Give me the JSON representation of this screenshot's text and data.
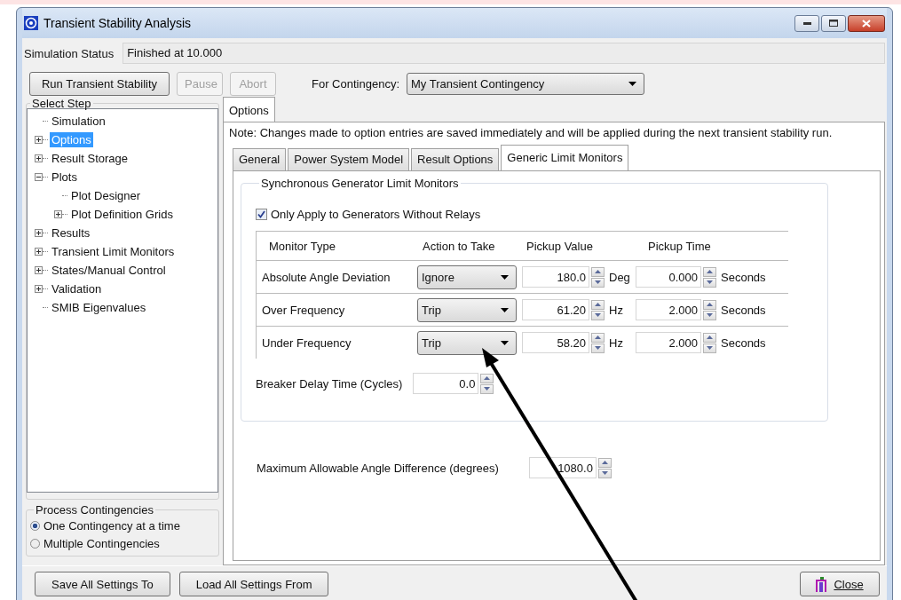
{
  "window": {
    "title": "Transient Stability Analysis"
  },
  "simulation_status": {
    "label": "Simulation Status",
    "value": "Finished at 10.000"
  },
  "toolbar": {
    "buttons": [
      {
        "label": "Run Transient Stability",
        "disabled": false
      },
      {
        "label": "Pause",
        "disabled": true
      },
      {
        "label": "Abort",
        "disabled": true
      }
    ],
    "contingency": {
      "label": "For Contingency:",
      "value": "My Transient Contingency"
    }
  },
  "select_step": {
    "title": "Select Step",
    "items": [
      {
        "label": "Simulation",
        "selected": false
      },
      {
        "label": "Options",
        "selected": true,
        "expanded": false
      },
      {
        "label": "Result Storage",
        "selected": false,
        "expanded": false
      },
      {
        "label": "Plots",
        "selected": false,
        "expanded": true,
        "children": [
          {
            "label": "Plot Designer",
            "selected": false
          },
          {
            "label": "Plot Definition Grids",
            "selected": false,
            "expanded": false
          }
        ]
      },
      {
        "label": "Results",
        "selected": false,
        "expanded": false
      },
      {
        "label": "Transient Limit Monitors",
        "selected": false,
        "expanded": false
      },
      {
        "label": "States/Manual Control",
        "selected": false,
        "expanded": false
      },
      {
        "label": "Validation",
        "selected": false,
        "expanded": false
      },
      {
        "label": "SMIB Eigenvalues",
        "selected": false
      }
    ]
  },
  "process_contingencies": {
    "title": "Process Contingencies",
    "options": [
      {
        "label": "One Contingency at a time",
        "selected": true
      },
      {
        "label": "Multiple Contingencies",
        "selected": false
      }
    ]
  },
  "outer_tabs": [
    {
      "label": "Options",
      "selected": true
    }
  ],
  "note": "Note: Changes made to option entries are saved immediately and will be applied during the next transient stability run.",
  "inner_tabs": [
    {
      "label": "General",
      "selected": false
    },
    {
      "label": "Power System Model",
      "selected": false
    },
    {
      "label": "Result Options",
      "selected": false
    },
    {
      "label": "Generic Limit Monitors",
      "selected": true
    }
  ],
  "generator_monitors": {
    "title": "Synchronous Generator Limit Monitors",
    "only_without_relays": {
      "label": "Only Apply to Generators Without Relays",
      "checked": true
    },
    "columns": [
      "Monitor Type",
      "Action to Take",
      "Pickup Value",
      "Pickup Time"
    ],
    "rows": [
      {
        "monitor_type": "Absolute Angle Deviation",
        "action": "Ignore",
        "pickup_value": "180.0",
        "value_unit": "Deg",
        "pickup_time": "0.000",
        "time_unit": "Seconds"
      },
      {
        "monitor_type": "Over Frequency",
        "action": "Trip",
        "pickup_value": "61.20",
        "value_unit": "Hz",
        "pickup_time": "2.000",
        "time_unit": "Seconds"
      },
      {
        "monitor_type": "Under Frequency",
        "action": "Trip",
        "pickup_value": "58.20",
        "value_unit": "Hz",
        "pickup_time": "2.000",
        "time_unit": "Seconds"
      }
    ],
    "breaker_delay": {
      "label": "Breaker Delay Time (Cycles)",
      "value": "0.0"
    }
  },
  "max_angle": {
    "label": "Maximum Allowable Angle Difference (degrees)",
    "value": "1080.0"
  },
  "footer": {
    "buttons": [
      "Save All Settings To",
      "Load All Settings From"
    ],
    "close": "Close"
  }
}
